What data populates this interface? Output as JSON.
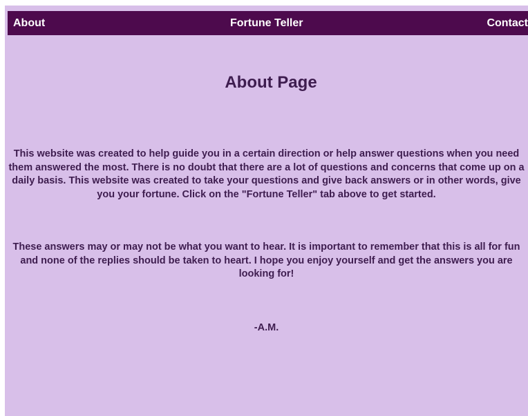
{
  "nav": {
    "about": "About",
    "fortune_teller": "Fortune Teller",
    "contact": "Contact"
  },
  "main": {
    "title": "About Page",
    "paragraph1_lines": [
      "This website was created to help guide you in a certain direction or help answer questions when you need",
      "them answered the most. There is no doubt that there are a lot of questions and concerns that come up on a",
      "daily basis. This website was created to take your questions and give back answers or in other words, give",
      "you your fortune. Click on the \"Fortune Teller\" tab above to get started."
    ],
    "paragraph2_lines": [
      "These answers may or may not be what you want to hear. It is important to remember that this is all for fun",
      "and none of the replies should be taken to heart. I hope you enjoy yourself and get the answers you are",
      "looking for!"
    ],
    "signature": "-A.M."
  },
  "colors": {
    "page_background": "#d8bfe9",
    "navbar_background": "#4d0a4d",
    "nav_text": "#ffffff",
    "body_text": "#3e1d4f"
  }
}
